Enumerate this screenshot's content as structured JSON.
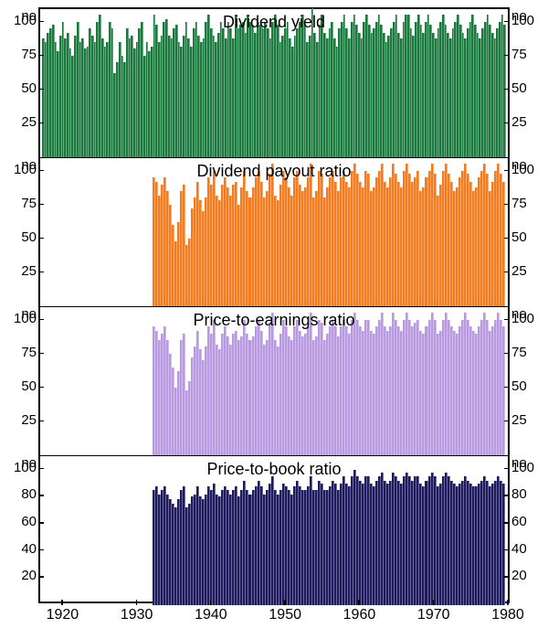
{
  "chart_data": [
    {
      "type": "bar",
      "title": "Dividend yield",
      "color": "#1a7a3e",
      "ylabel": "no",
      "ylim": [
        0,
        110
      ],
      "yticks": [
        25,
        50,
        75,
        100
      ],
      "x_start": 1917,
      "x_end": 1980,
      "data_start": 1917,
      "values": [
        88,
        85,
        92,
        95,
        98,
        85,
        78,
        90,
        100,
        88,
        92,
        80,
        75,
        90,
        100,
        85,
        88,
        80,
        82,
        95,
        90,
        85,
        100,
        105,
        88,
        82,
        85,
        100,
        95,
        62,
        70,
        85,
        75,
        70,
        95,
        88,
        90,
        80,
        85,
        95,
        100,
        75,
        85,
        78,
        82,
        105,
        98,
        85,
        90,
        100,
        102,
        90,
        88,
        95,
        98,
        85,
        82,
        90,
        100,
        88,
        82,
        95,
        100,
        90,
        85,
        88,
        100,
        105,
        95,
        90,
        85,
        92,
        100,
        95,
        88,
        100,
        95,
        88,
        105,
        95,
        98,
        100,
        92,
        105,
        100,
        98,
        92,
        100,
        98,
        95,
        100,
        95,
        88,
        100,
        105,
        98,
        85,
        90,
        95,
        100,
        88,
        82,
        90,
        95,
        100,
        105,
        98,
        85,
        90,
        110,
        92,
        85,
        98,
        105,
        92,
        88,
        95,
        100,
        88,
        82,
        95,
        100,
        105,
        95,
        88,
        100,
        105,
        98,
        92,
        88,
        100,
        105,
        98,
        92,
        95,
        100,
        105,
        98,
        92,
        85,
        90,
        95,
        100,
        105,
        92,
        88,
        100,
        105,
        105,
        95,
        90,
        100,
        105,
        98,
        92,
        100,
        105,
        98,
        92,
        88,
        95,
        100,
        105,
        98,
        92,
        88,
        95,
        100,
        105,
        98,
        92,
        88,
        95,
        100,
        105,
        98,
        92,
        88,
        95,
        100,
        105,
        98,
        92,
        88,
        95,
        100,
        105,
        98
      ]
    },
    {
      "type": "bar",
      "title": "Dividend payout ratio",
      "color": "#f47b20",
      "ylabel": "no",
      "ylim": [
        0,
        110
      ],
      "yticks": [
        25,
        50,
        75,
        100
      ],
      "x_start": 1917,
      "x_end": 1980,
      "data_start": 1937,
      "values": [
        95,
        92,
        82,
        90,
        95,
        85,
        75,
        60,
        48,
        62,
        85,
        90,
        45,
        50,
        72,
        80,
        92,
        78,
        70,
        80,
        95,
        90,
        100,
        82,
        78,
        90,
        95,
        88,
        82,
        90,
        92,
        75,
        88,
        100,
        85,
        80,
        88,
        95,
        100,
        92,
        80,
        85,
        98,
        105,
        82,
        78,
        90,
        100,
        95,
        88,
        82,
        95,
        100,
        90,
        85,
        88,
        95,
        105,
        80,
        85,
        100,
        98,
        80,
        88,
        95,
        100,
        92,
        85,
        95,
        100,
        92,
        88,
        100,
        105,
        98,
        92,
        88,
        100,
        98,
        85,
        88,
        95,
        100,
        105,
        92,
        88,
        95,
        105,
        98,
        92,
        88,
        100,
        105,
        98,
        92,
        95,
        100,
        85,
        88,
        95,
        100,
        105,
        98,
        82,
        90,
        100,
        105,
        98,
        92,
        85,
        88,
        95,
        100,
        105,
        98,
        92,
        85,
        88,
        95,
        100,
        105,
        98,
        85,
        92,
        100,
        105,
        98,
        92
      ]
    },
    {
      "type": "bar",
      "title": "Price-to-earnings ratio",
      "color": "#b99ae0",
      "ylabel": "no",
      "ylim": [
        0,
        110
      ],
      "yticks": [
        25,
        50,
        75,
        100
      ],
      "x_start": 1917,
      "x_end": 1980,
      "data_start": 1937,
      "values": [
        95,
        92,
        85,
        90,
        95,
        85,
        75,
        65,
        50,
        62,
        85,
        90,
        48,
        55,
        72,
        80,
        92,
        78,
        70,
        80,
        95,
        90,
        100,
        82,
        78,
        90,
        95,
        88,
        82,
        90,
        92,
        85,
        88,
        100,
        90,
        85,
        88,
        95,
        100,
        92,
        82,
        85,
        98,
        105,
        85,
        80,
        90,
        100,
        95,
        88,
        85,
        95,
        100,
        92,
        88,
        90,
        95,
        105,
        85,
        88,
        100,
        98,
        85,
        90,
        95,
        100,
        95,
        88,
        95,
        100,
        95,
        90,
        100,
        105,
        100,
        95,
        92,
        100,
        100,
        92,
        90,
        95,
        100,
        105,
        95,
        92,
        95,
        105,
        100,
        95,
        92,
        100,
        105,
        100,
        95,
        98,
        100,
        92,
        90,
        95,
        100,
        105,
        100,
        90,
        92,
        100,
        105,
        100,
        95,
        92,
        90,
        95,
        100,
        105,
        100,
        95,
        92,
        90,
        95,
        100,
        105,
        100,
        92,
        95,
        100,
        105,
        100,
        95
      ]
    },
    {
      "type": "bar",
      "title": "Price-to-book ratio",
      "color": "#1e1a5e",
      "ylabel": "no",
      "ylim": [
        0,
        110
      ],
      "yticks": [
        20,
        40,
        60,
        80,
        100
      ],
      "x_start": 1917,
      "x_end": 1980,
      "data_start": 1937,
      "values": [
        85,
        88,
        82,
        85,
        88,
        82,
        78,
        75,
        72,
        78,
        85,
        88,
        72,
        75,
        80,
        82,
        88,
        80,
        78,
        82,
        88,
        85,
        90,
        82,
        80,
        85,
        88,
        85,
        82,
        85,
        88,
        80,
        85,
        92,
        85,
        82,
        85,
        88,
        92,
        88,
        82,
        85,
        90,
        95,
        85,
        82,
        85,
        90,
        88,
        85,
        82,
        88,
        92,
        88,
        85,
        85,
        88,
        95,
        85,
        85,
        92,
        90,
        85,
        85,
        88,
        92,
        90,
        85,
        90,
        95,
        90,
        88,
        95,
        100,
        95,
        92,
        90,
        95,
        95,
        90,
        88,
        92,
        95,
        98,
        92,
        90,
        92,
        98,
        95,
        92,
        90,
        95,
        98,
        95,
        92,
        95,
        95,
        90,
        88,
        92,
        95,
        98,
        95,
        88,
        90,
        95,
        98,
        95,
        92,
        90,
        88,
        90,
        92,
        95,
        92,
        90,
        88,
        88,
        90,
        92,
        95,
        92,
        88,
        90,
        92,
        95,
        92,
        90
      ]
    }
  ],
  "xticks": [
    1920,
    1930,
    1940,
    1950,
    1960,
    1970,
    1980
  ]
}
